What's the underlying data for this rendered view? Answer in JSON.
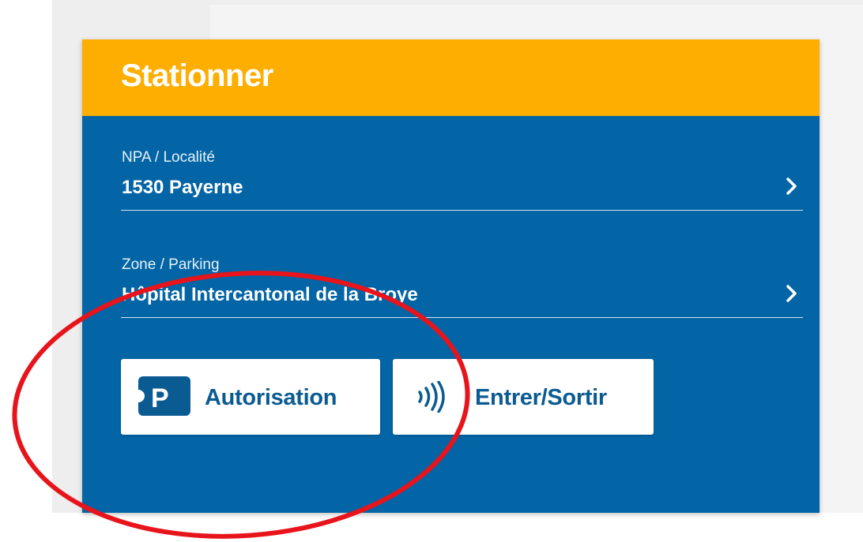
{
  "card": {
    "title": "Stationner",
    "header_color": "#fdae00",
    "body_color": "#0365a5"
  },
  "locality": {
    "label": "NPA / Localité",
    "value": "1530 Payerne"
  },
  "zone": {
    "label": "Zone / Parking",
    "value": "Hôpital Intercantonal de la Broye"
  },
  "buttons": {
    "authorization": {
      "label": "Autorisation",
      "icon": "parking-permit-icon"
    },
    "enter_exit": {
      "label": "Entrer/Sortir",
      "icon": "nfc-contactless-icon"
    }
  },
  "annotation": {
    "shape": "ellipse",
    "color": "#e8141c"
  }
}
